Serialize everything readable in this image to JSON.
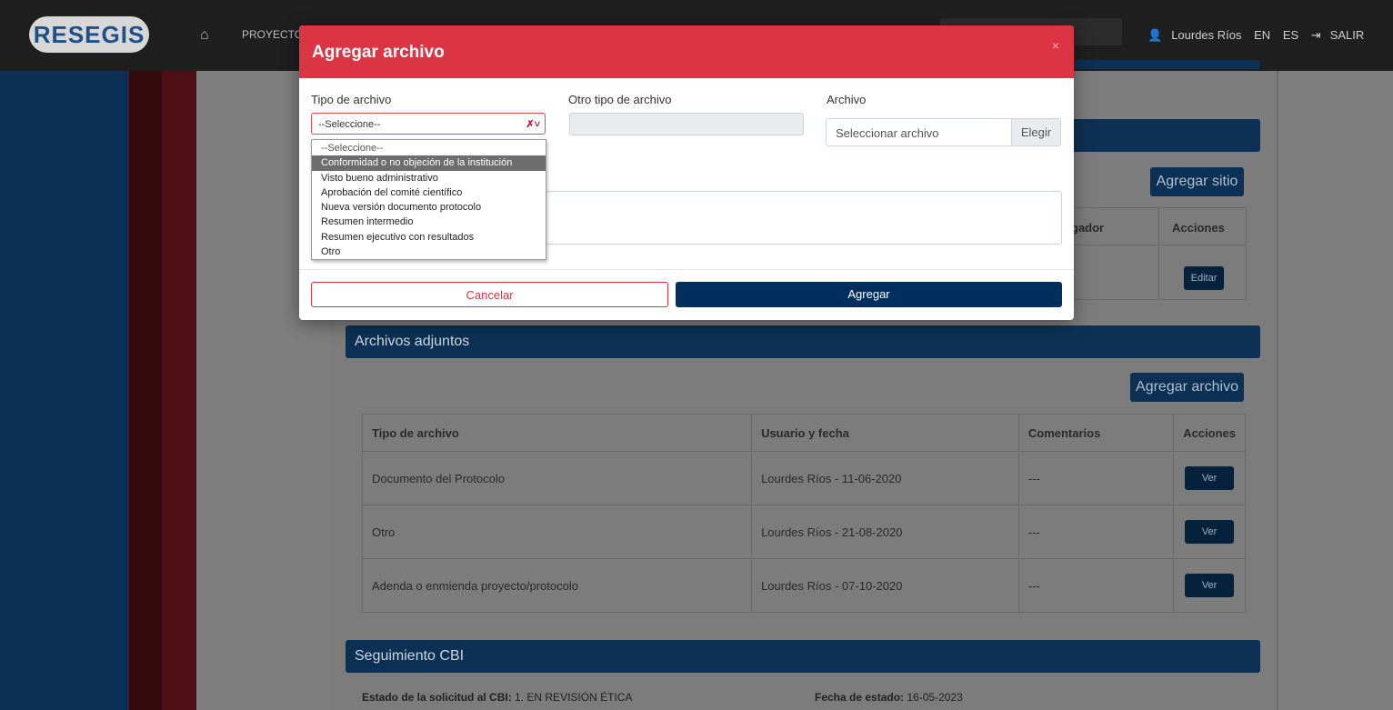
{
  "header": {
    "logo_text": "RESEGIS",
    "nav_proyectos": "PROYECTO",
    "user_name": "Lourdes Ríos",
    "lang_en": "EN",
    "lang_es": "ES",
    "logout_label": "SALIR"
  },
  "background": {
    "add_site_label": "Agregar sitio",
    "sites_table": {
      "col_investigador": "gador",
      "col_acciones": "Acciones",
      "edit_label": "Editar"
    },
    "attachments": {
      "title": "Archivos adjuntos",
      "add_file_label": "Agregar archivo",
      "columns": [
        "Tipo de archivo",
        "Usuario y fecha",
        "Comentarios",
        "Acciones"
      ],
      "rows": [
        {
          "tipo": "Documento del Protocolo",
          "usuario_fecha": "Lourdes Ríos - 11-06-2020",
          "comentarios": "---",
          "accion": "Ver"
        },
        {
          "tipo": "Otro",
          "usuario_fecha": "Lourdes Ríos - 21-08-2020",
          "comentarios": "---",
          "accion": "Ver"
        },
        {
          "tipo": "Adenda o enmienda proyecto/protocolo",
          "usuario_fecha": "Lourdes Ríos - 07-10-2020",
          "comentarios": "---",
          "accion": "Ver"
        }
      ]
    },
    "seguimiento": {
      "title": "Seguimiento CBI",
      "estado_label": "Estado de la solicitud al CBI:",
      "estado_value": "1. EN REVISIÓN ÉTICA",
      "fecha_label": "Fecha de estado:",
      "fecha_value": "16-05-2023"
    }
  },
  "modal": {
    "title": "Agregar archivo",
    "close_glyph": "×",
    "tipo_label": "Tipo de archivo",
    "otro_label": "Otro tipo de archivo",
    "archivo_label": "Archivo",
    "select_value": "--Seleccione--",
    "options": [
      "--Seleccione--",
      "Conformidad o no objeción de la institución",
      "Visto bueno administrativo",
      "Aprobación del comité científico",
      "Nueva versión documento protocolo",
      "Resumen intermedio",
      "Resumen ejecutivo con resultados",
      "Otro"
    ],
    "highlighted_option_index": 1,
    "file_placeholder": "Seleccionar archivo",
    "file_button": "Elegir",
    "cancel_label": "Cancelar",
    "add_label": "Agregar"
  },
  "colors": {
    "modal_header": "#db3545",
    "primary": "#002e5d"
  }
}
